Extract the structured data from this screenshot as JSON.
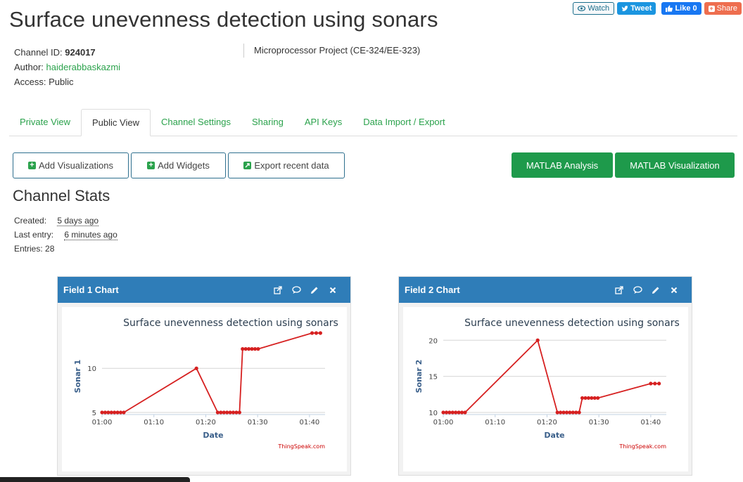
{
  "page": {
    "title": "Surface unevenness detection using sonars"
  },
  "social": {
    "watch": "Watch",
    "tweet": "Tweet",
    "like": "Like 0",
    "share": "Share"
  },
  "channel": {
    "id_label": "Channel ID:",
    "id_value": "924017",
    "author_label": "Author:",
    "author_value": "haiderabbaskazmi",
    "access_label": "Access:",
    "access_value": "Public",
    "description": "Microprocessor Project (CE-324/EE-323)"
  },
  "tabs": [
    {
      "label": "Private View"
    },
    {
      "label": "Public View"
    },
    {
      "label": "Channel Settings"
    },
    {
      "label": "Sharing"
    },
    {
      "label": "API Keys"
    },
    {
      "label": "Data Import / Export"
    }
  ],
  "actions": {
    "add_visualizations": "Add Visualizations",
    "add_widgets": "Add Widgets",
    "export_recent": "Export recent data",
    "matlab_analysis": "MATLAB Analysis",
    "matlab_visualization": "MATLAB Visualization"
  },
  "stats": {
    "heading": "Channel Stats",
    "created_label": "Created:",
    "created_value": "5 days ago",
    "last_entry_label": "Last entry:",
    "last_entry_value": "6 minutes ago",
    "entries_label": "Entries:",
    "entries_value": "28"
  },
  "colors": {
    "accent_green": "#1e9a4b",
    "link_green": "#2ba24c",
    "panel_blue": "#2f7db8",
    "series_red": "#d62020"
  },
  "icons": [
    "eye-icon",
    "twitter-icon",
    "like-icon",
    "plus-icon",
    "export-icon",
    "popout-icon",
    "comment-icon",
    "pencil-icon",
    "close-icon"
  ],
  "panels": [
    {
      "title": "Field 1 Chart"
    },
    {
      "title": "Field 2 Chart"
    }
  ],
  "chart_data": [
    {
      "type": "line",
      "title": "Surface unevenness detection using sonars",
      "xlabel": "Date",
      "ylabel": "Sonar 1",
      "credit": "ThingSpeak.com",
      "x_ticks": [
        "01:00",
        "01:10",
        "01:20",
        "01:30",
        "01:40"
      ],
      "y_ticks": [
        5,
        10
      ],
      "xlim": [
        0,
        43
      ],
      "ylim": [
        5,
        14
      ],
      "grid": true,
      "series": [
        {
          "x": [
            0,
            0.6,
            1.2,
            1.8,
            2.4,
            3.0,
            3.6,
            4.2,
            18.2,
            22.3,
            22.9,
            23.5,
            24.1,
            24.7,
            25.3,
            25.9,
            26.5,
            27.1,
            27.7,
            28.3,
            28.9,
            29.5,
            30.1,
            40.5,
            41.3,
            42.1
          ],
          "y": [
            5,
            5,
            5,
            5,
            5,
            5,
            5,
            5,
            10,
            5,
            5,
            5,
            5,
            5,
            5,
            5,
            5,
            12.2,
            12.2,
            12.2,
            12.2,
            12.2,
            12.2,
            14,
            14,
            14
          ]
        }
      ]
    },
    {
      "type": "line",
      "title": "Surface unevenness detection using sonars",
      "xlabel": "Date",
      "ylabel": "Sonar 2",
      "credit": "ThingSpeak.com",
      "x_ticks": [
        "01:00",
        "01:10",
        "01:20",
        "01:30",
        "01:40"
      ],
      "y_ticks": [
        10,
        15,
        20
      ],
      "xlim": [
        0,
        43
      ],
      "ylim": [
        10,
        21
      ],
      "grid": true,
      "series": [
        {
          "x": [
            0,
            0.6,
            1.2,
            1.8,
            2.4,
            3.0,
            3.6,
            4.2,
            18.2,
            22.0,
            22.6,
            23.2,
            23.8,
            24.4,
            25.0,
            25.6,
            26.2,
            26.8,
            27.4,
            28.0,
            28.6,
            29.2,
            29.8,
            40.0,
            40.8,
            41.6
          ],
          "y": [
            10,
            10,
            10,
            10,
            10,
            10,
            10,
            10,
            20,
            10,
            10,
            10,
            10,
            10,
            10,
            10,
            10,
            12,
            12,
            12,
            12,
            12,
            12,
            14,
            14,
            14
          ]
        }
      ]
    }
  ]
}
